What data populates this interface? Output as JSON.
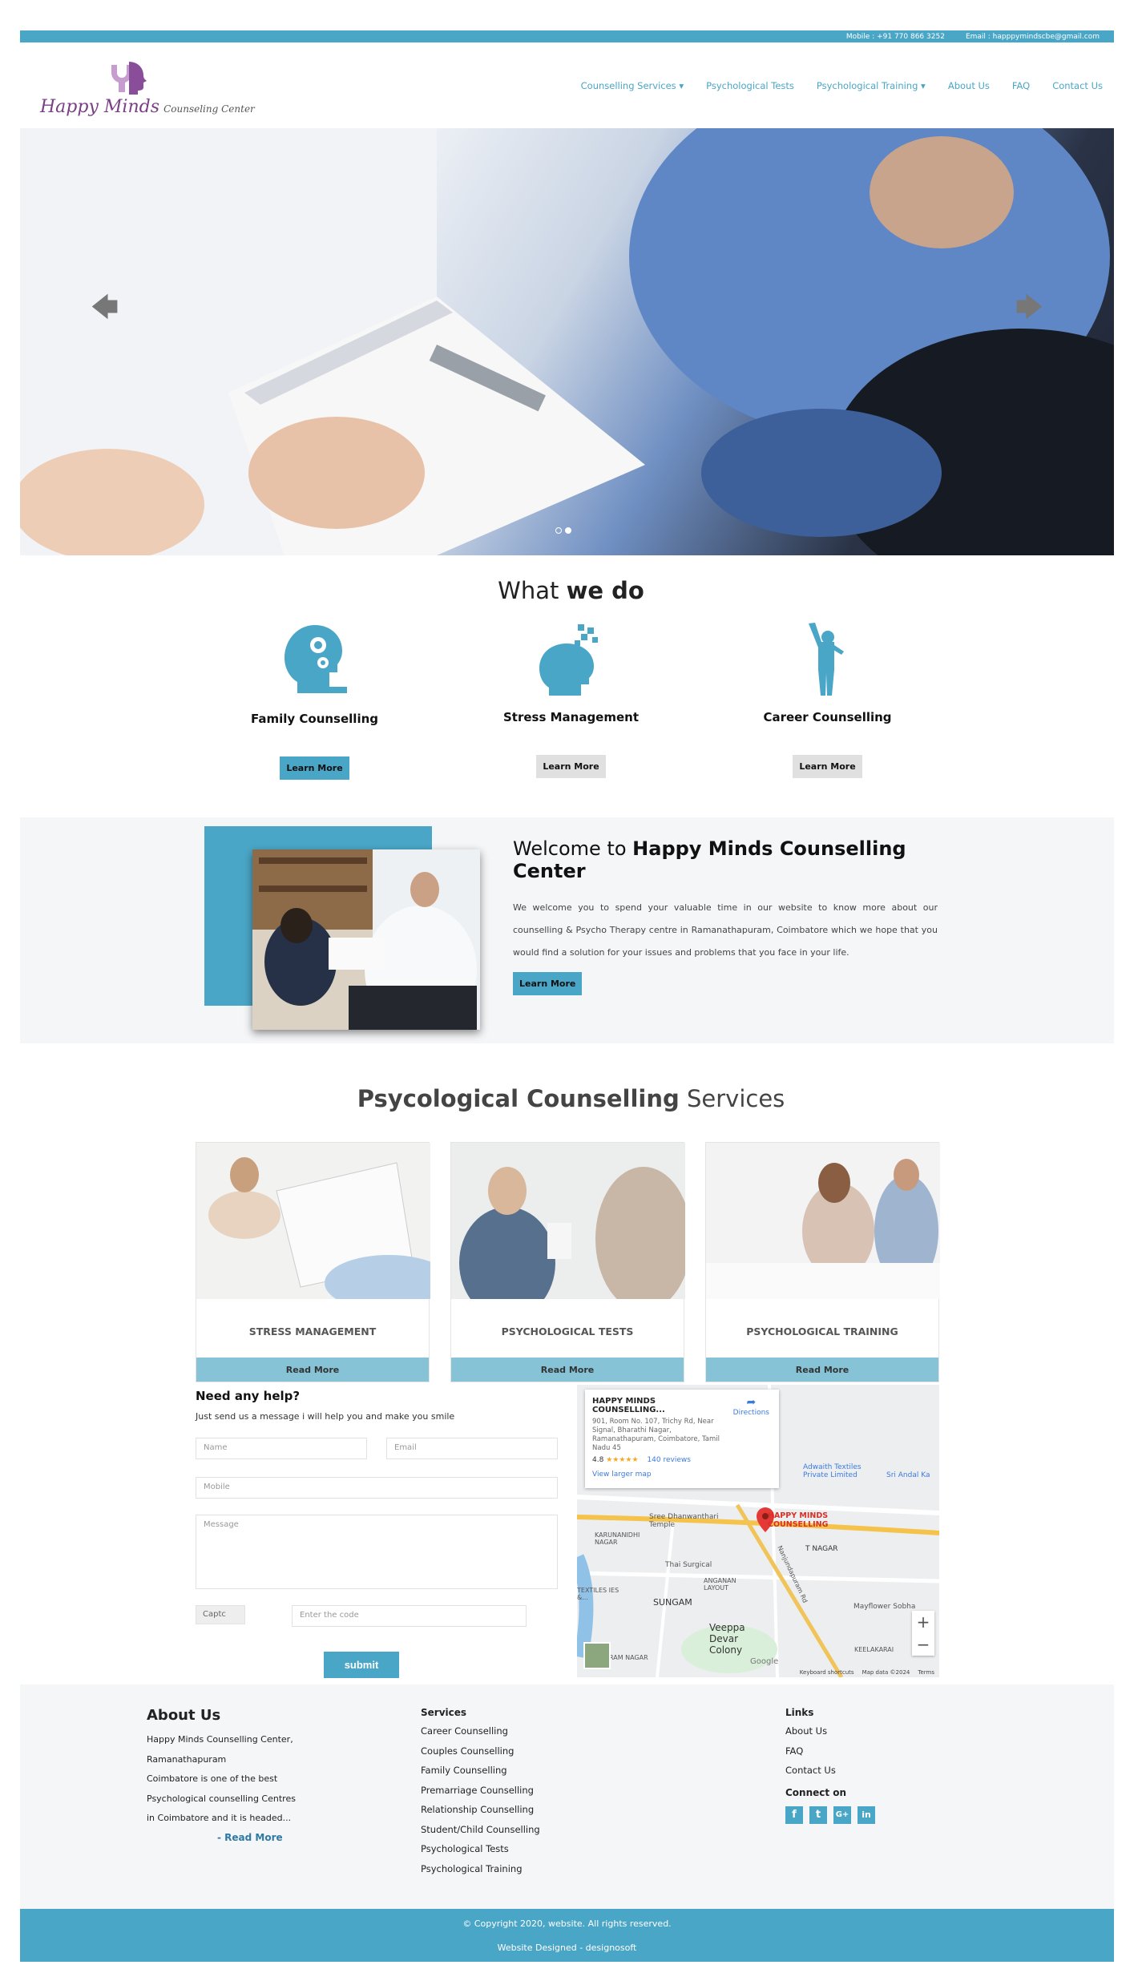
{
  "topbar": {
    "mobile": "Mobile : +91 770 866 3252",
    "email": "Email : happpymindscbe@gmail.com"
  },
  "logo": {
    "name": "Happy Minds",
    "tagline": "Counseling Center"
  },
  "nav": [
    "Counselling Services",
    "Psychological Tests",
    "Psychological Training",
    "About Us",
    "FAQ",
    "Contact Us"
  ],
  "hero": {
    "prev_icon": "arrow-left-icon",
    "next_icon": "arrow-right-icon",
    "slides": 2,
    "active_slide": 2
  },
  "what_we_do": {
    "title_light": "What",
    "title_bold": "we do",
    "items": [
      {
        "name": "Family Counselling",
        "button": "Learn More"
      },
      {
        "name": "Stress Management",
        "button": "Learn More"
      },
      {
        "name": "Career Counselling",
        "button": "Learn More"
      }
    ]
  },
  "welcome": {
    "title_light": "Welcome to",
    "title_bold": "Happy Minds Counselling Center",
    "text": "We welcome you to spend your valuable time in our website to know more about our counselling & Psycho Therapy centre in Ramanathapuram, Coimbatore which we hope that you would find a solution for your issues and problems that you face in your life.",
    "button": "Learn More"
  },
  "services": {
    "title_bold": "Psycological Counselling",
    "title_light": "Services",
    "cards": [
      {
        "name": "STRESS MANAGEMENT",
        "button": "Read More"
      },
      {
        "name": "PSYCHOLOGICAL TESTS",
        "button": "Read More"
      },
      {
        "name": "PSYCHOLOGICAL TRAINING",
        "button": "Read More"
      }
    ]
  },
  "help": {
    "title": "Need any help?",
    "subtitle": "Just send us a message i will help you and make you smile",
    "name_placeholder": "Name",
    "email_placeholder": "Email",
    "mobile_placeholder": "Mobile",
    "message_placeholder": "Message",
    "captcha_alt": "Captc",
    "code_placeholder": "Enter the code",
    "submit": "submit"
  },
  "map": {
    "place": "HAPPY MINDS COUNSELLING...",
    "address": "901, Room No. 107, Trichy Rd, Near Signal, Bharathi Nagar, Ramanathapuram, Coimbatore, Tamil Nadu 45",
    "rating": "4.8",
    "stars": "★★★★★",
    "reviews": "140 reviews",
    "larger": "View larger map",
    "directions": "Directions",
    "pin_label": "HAPPY MINDS COUNSELLING",
    "labels": [
      "Adwaith Textiles Private Limited",
      "Sri Andal Ka",
      "Sree Dhanwanthari Temple",
      "T NAGAR",
      "Thai Surgical",
      "SUNGAM",
      "Veeppa Devar Colony",
      "Mayflower Sobha",
      "KEELAKARAI",
      "RAM NAGAR",
      "KARUNANIDHI NAGAR",
      "ANGANAN LAYOUT",
      "TEXTILES IES &...",
      "Nanjundapuram Rd"
    ],
    "footer": [
      "Keyboard shortcuts",
      "Map data ©2024",
      "Terms"
    ],
    "google": "Google"
  },
  "footer": {
    "about_title": "About Us",
    "about_lines": [
      "Happy Minds Counselling Center,",
      "Ramanathapuram",
      "Coimbatore is one of the best",
      "Psychological counselling Centres",
      "in Coimbatore and it is headed..."
    ],
    "read_more": "- Read More",
    "services_title": "Services",
    "services": [
      "Career Counselling",
      "Couples Counselling",
      "Family Counselling",
      "Premarriage Counselling",
      "Relationship Counselling",
      "Student/Child Counselling",
      "Psychological Tests",
      "Psychological Training"
    ],
    "links_title": "Links",
    "links": [
      "About Us",
      "FAQ",
      "Contact Us"
    ],
    "connect_title": "Connect on",
    "social": [
      "f",
      "t",
      "G+",
      "in"
    ]
  },
  "copyright": {
    "line1": "© Copyright 2020, website. All rights reserved.",
    "line2": "Website Designed - designosoft"
  },
  "colors": {
    "accent": "#4aa6c7",
    "logo_purple": "#7a3f87",
    "card_button": "#86c3d6"
  }
}
